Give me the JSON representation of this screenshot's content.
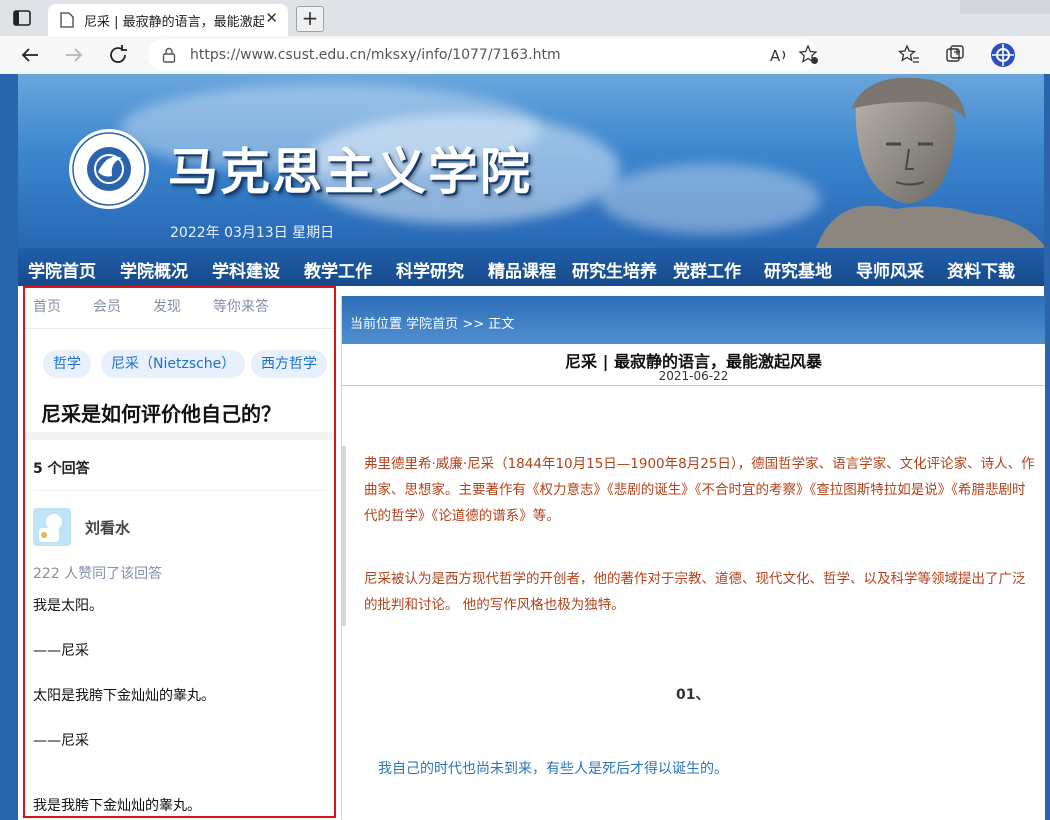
{
  "browser": {
    "tab_title": "尼采 | 最寂静的语言，最能激起风暴",
    "tab_close": "✕",
    "new_tab": "+",
    "url": "https://www.csust.edu.cn/mksxy/info/1077/7163.htm"
  },
  "banner": {
    "title": "马克思主义学院",
    "date": "2022年 03月13日 星期日"
  },
  "nav": {
    "items": [
      "学院首页",
      "学院概况",
      "学科建设",
      "教学工作",
      "科学研究",
      "精品课程",
      "研究生培养",
      "党群工作",
      "研究基地",
      "导师风采",
      "资料下载"
    ]
  },
  "answer_panel": {
    "nav": [
      "首页",
      "会员",
      "发现",
      "等你来答"
    ],
    "tags": [
      "哲学",
      "尼采（Nietzsche）",
      "西方哲学"
    ],
    "question": "尼采是如何评价他自己的？",
    "answer_count": "5 个回答",
    "author": "刘看水",
    "upvotes": "222 人赞同了该回答",
    "lines": [
      "我是太阳。",
      "——尼采",
      "太阳是我胯下金灿灿的睾丸。",
      "——尼采",
      "我是我胯下金灿灿的睾丸。"
    ]
  },
  "article": {
    "crumb_label": "当前位置",
    "crumb_home": "学院首页",
    "crumb_tail": ">> 正文",
    "title": "尼采 | 最寂静的语言，最能激起风暴",
    "date": "2021-06-22",
    "para1": "弗里德里希·威廉·尼采（1844年10月15日—1900年8月25日），德国哲学家、语言学家、文化评论家、诗人、作曲家、思想家。主要著作有《权力意志》《悲剧的诞生》《不合时宜的考察》《查拉图斯特拉如是说》《希腊悲剧时代的哲学》《论道德的谱系》等。",
    "para2": "尼采被认为是西方现代哲学的开创者，他的著作对于宗教、道德、现代文化、哲学、以及科学等领域提出了广泛的批判和讨论。 他的写作风格也极为独特。",
    "section": "01、",
    "quote": "我自己的时代也尚未到来，有些人是死后才得以诞生的。"
  },
  "colors": {
    "nav_bg": "#1f5ea8",
    "highlight_border": "#d8141c",
    "para_text": "#b2421a",
    "quote_text": "#2a77b8",
    "tag_bg": "#e8f0fb"
  }
}
